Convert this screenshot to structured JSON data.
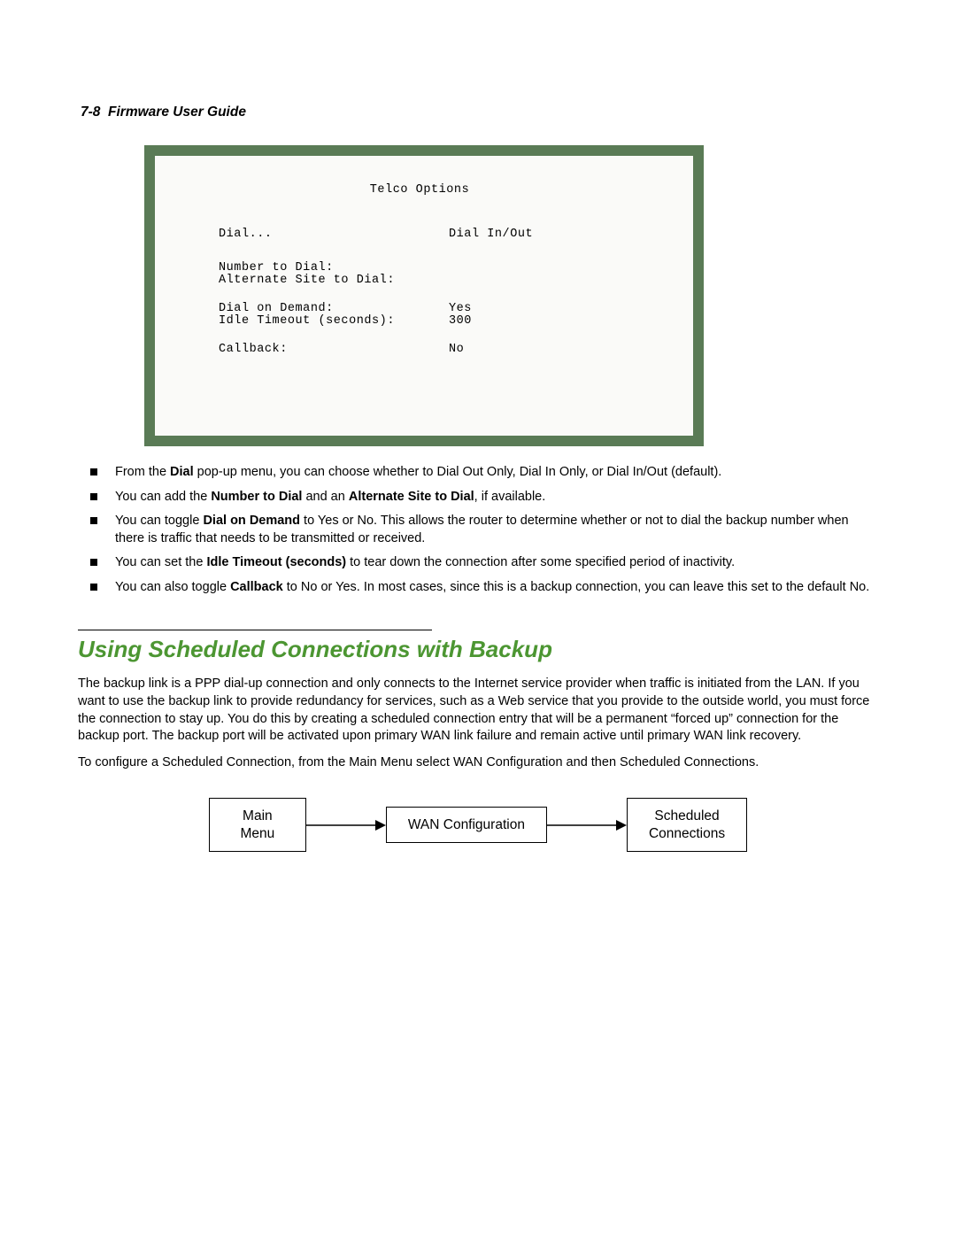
{
  "header": {
    "page_number": "7-8",
    "title": "Firmware User Guide"
  },
  "terminal": {
    "title": "Telco Options",
    "rows": [
      {
        "label": "Dial...",
        "value": "Dial In/Out",
        "gap_after": 24
      },
      {
        "label": "Number to Dial:",
        "value": "",
        "gap_after": 0
      },
      {
        "label": "Alternate Site to Dial:",
        "value": "",
        "gap_after": 18
      },
      {
        "label": "Dial on Demand:",
        "value": "Yes",
        "gap_after": 0
      },
      {
        "label": "Idle Timeout (seconds):",
        "value": "300",
        "gap_after": 18
      },
      {
        "label": "Callback:",
        "value": "No",
        "gap_after": 0
      }
    ]
  },
  "bullets": [
    {
      "html": "From the <b>Dial</b> pop-up menu, you can choose whether to Dial Out Only, Dial In Only, or Dial In/Out (default)."
    },
    {
      "html": "You can add the <b>Number to Dial</b> and an <b>Alternate Site to Dial</b>, if available."
    },
    {
      "html": "You can toggle <b>Dial on Demand</b> to Yes or No. This allows the router to determine whether or not to dial the backup number when there is traffic that needs to be transmitted or received."
    },
    {
      "html": "You can set the <b>Idle Timeout (seconds)</b> to tear down the connection after some specified period of inactivity."
    },
    {
      "html": "You can also toggle <b>Callback</b> to No or Yes. In most cases, since this is a backup connection, you can leave this set to the default No."
    }
  ],
  "section": {
    "heading": "Using Scheduled Connections with Backup",
    "p1": "The backup link is a PPP dial-up connection and only connects to the Internet service provider when traffic is initiated from the LAN. If you want to use the backup link to provide redundancy for services, such as a Web service that you provide to the outside world, you must force the connection to stay up. You do this by creating a scheduled connection entry that will be a permanent “forced up” connection for the backup port. The backup port will be activated upon primary WAN link failure and remain active until primary WAN link recovery.",
    "p2": "To configure a Scheduled Connection, from the Main Menu select WAN Configuration and then Scheduled Connections."
  },
  "flow": {
    "box1_line1": "Main",
    "box1_line2": "Menu",
    "box2": "WAN Configuration",
    "box3_line1": "Scheduled",
    "box3_line2": "Connections"
  }
}
